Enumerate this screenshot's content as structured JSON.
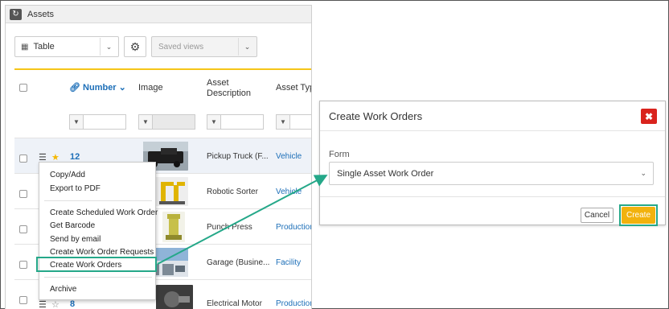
{
  "panel": {
    "title": "Assets",
    "refresh_icon": "refresh-icon"
  },
  "toolbar": {
    "view_select": "Table",
    "view_icon": "grid-icon",
    "settings_icon": "gear-icon",
    "saved_views_placeholder": "Saved views"
  },
  "columns": {
    "number": "Number",
    "image": "Image",
    "asset_description": "Asset Description",
    "asset_type": "Asset Typ"
  },
  "rows": [
    {
      "number": "12",
      "starred": true,
      "description": "Pickup Truck (F...",
      "type": "Vehicle"
    },
    {
      "number": "",
      "starred": false,
      "description": "Robotic Sorter",
      "type": "Vehicle"
    },
    {
      "number": "",
      "starred": false,
      "description": "Punch Press",
      "type": "Production"
    },
    {
      "number": "",
      "starred": false,
      "description": "Garage (Busine...",
      "type": "Facility"
    },
    {
      "number": "8",
      "starred": false,
      "description": "Electrical Motor",
      "type": "Production"
    }
  ],
  "context_menu": {
    "items": [
      "Copy/Add",
      "Export to PDF",
      "Create Scheduled Work Order",
      "Get Barcode",
      "Send by email",
      "Create Work Order Requests",
      "Create Work Orders",
      "Archive"
    ],
    "highlighted": "Create Work Orders"
  },
  "dialog": {
    "title": "Create Work Orders",
    "form_label": "Form",
    "form_value": "Single Asset Work Order",
    "cancel_label": "Cancel",
    "create_label": "Create"
  },
  "colors": {
    "accent_green": "#25a889",
    "create_yellow": "#f2b20d",
    "close_red": "#d9231d",
    "link_blue": "#1d6fb8",
    "tab_yellow": "#f5c518"
  }
}
